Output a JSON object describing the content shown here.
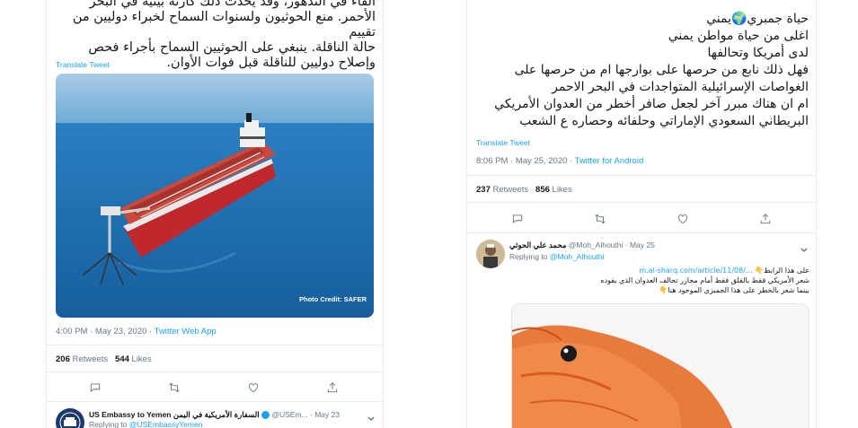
{
  "left_tweet": {
    "body_lines": [
      "ألقاء في التدهور، وقد يحدث ذلك كارثة بيئية في البحر",
      "الأحمر. منع الحوثيون ولسنوات السماح لخبراء دوليين من تقييم",
      "حالة الناقلة.  ينبغي على الحوثيين السماح بأجراء فحص",
      "وإصلاح دوليين للناقلة قبل فوات الأوان."
    ],
    "translate": "Translate Tweet",
    "photo_credit": "Photo Credit: SAFER",
    "time": "4:00 PM · May 23, 2020 · ",
    "source": "Twitter Web App",
    "retweets_count": "206",
    "retweets_label": "Retweets",
    "likes_count": "544",
    "likes_label": "Likes"
  },
  "left_reply": {
    "name": "US Embassy to Yemen",
    "arabic_name": "السفارة الأمريكية في اليمن",
    "handle": "@USEm...",
    "date": "· May 23",
    "replying_to_label": "Replying to",
    "replying_to_handle": "@USEmbassyYemen"
  },
  "right_tweet": {
    "body_lines": [
      "حياة جمبري🌍يمني",
      "اغلى من حياة مواطن يمني",
      "لدى أمريكا وتحالفها",
      "فهل ذلك نابع من حرصها على بوارجها ام من حرصها على",
      "الغواصات الإسرائيلية المتواجدات في البحر الاحمر",
      "ام ان هناك مبرر آخر لجعل صافر أخطر من العدوان الأمريكي",
      "البريطاني السعودي الإماراتي وحلفائه وحصاره ع الشعب"
    ],
    "translate": "Translate Tweet",
    "time": "8:06 PM · May 25, 2020 · ",
    "source": "Twitter for Android",
    "retweets_count": "237",
    "retweets_label": "Retweets",
    "likes_count": "856",
    "likes_label": "Likes"
  },
  "right_reply": {
    "name": "محمد علي الحوثي",
    "handle": "@Moh_Alhouthi",
    "date": "· May 25",
    "replying_to_label": "Replying to",
    "replying_to_handle": "@Moh_Alhouthi",
    "line1_prefix": "على هذا الرابط👇",
    "link": "m.al-sharq.com/article/11/08/...",
    "line2": "شعر الأمريكي فقط بالقلق فقط أمام مجازر تحالف العدوان الذي يقوده",
    "line3": "بينما شعر بالخطر على هذا الجمبري الموجود هنا👇"
  },
  "icons": {
    "reply": "reply-icon",
    "retweet": "retweet-icon",
    "like": "heart-icon",
    "share": "share-icon",
    "verified": "verified-badge-icon",
    "chevron": "chevron-down-icon"
  },
  "colors": {
    "link": "#1da1f2",
    "muted": "#657786",
    "text": "#14171a",
    "border": "#e6ecf0"
  }
}
